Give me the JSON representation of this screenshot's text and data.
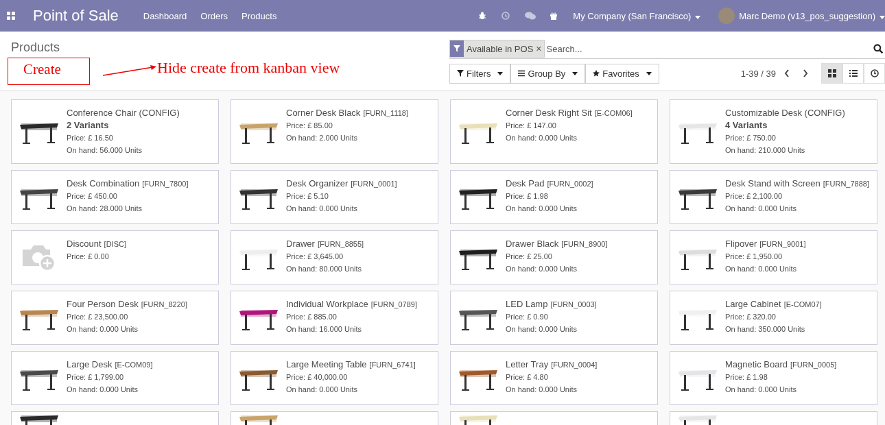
{
  "navbar": {
    "app_title": "Point of Sale",
    "menu": [
      {
        "label": "Dashboard"
      },
      {
        "label": "Orders"
      },
      {
        "label": "Products"
      }
    ],
    "company": "My Company (San Francisco)",
    "user": "Marc Demo (v13_pos_suggestion)"
  },
  "control_panel": {
    "breadcrumb": "Products",
    "facet": "Available in POS",
    "facet_remove": "×",
    "search_placeholder": "Search...",
    "filters": [
      {
        "kind": "filter",
        "label": "Filters"
      },
      {
        "kind": "group",
        "label": "Group By"
      },
      {
        "kind": "star",
        "label": "Favorites"
      }
    ],
    "pager": "1-39 / 39",
    "views": [
      {
        "kind": "kanban",
        "selected": true
      },
      {
        "kind": "list",
        "selected": false
      },
      {
        "kind": "activity",
        "selected": false
      }
    ]
  },
  "annotation": {
    "box_text": "Create",
    "note": "Hide create from kanban view"
  },
  "products": [
    {
      "name": "Conference Chair (CONFIG)",
      "variants": "2 Variants",
      "price": "Price: £ 16.50",
      "on_hand": "On hand: 56.000 Units",
      "kind": "picture"
    },
    {
      "name": "Corner Desk Black",
      "code": "[FURN_1118]",
      "price": "Price: £ 85.00",
      "on_hand": "On hand: 2.000 Units",
      "kind": "picture"
    },
    {
      "name": "Corner Desk Right Sit",
      "code": "[E-COM06]",
      "price": "Price: £ 147.00",
      "on_hand": "On hand: 0.000 Units",
      "kind": "picture"
    },
    {
      "name": "Customizable Desk (CONFIG)",
      "variants": "4 Variants",
      "price": "Price: £ 750.00",
      "on_hand": "On hand: 210.000 Units",
      "kind": "picture"
    },
    {
      "name": "Desk Combination",
      "code": "[FURN_7800]",
      "price": "Price: £ 450.00",
      "on_hand": "On hand: 28.000 Units",
      "kind": "picture"
    },
    {
      "name": "Desk Organizer",
      "code": "[FURN_0001]",
      "price": "Price: £ 5.10",
      "on_hand": "On hand: 0.000 Units",
      "kind": "picture"
    },
    {
      "name": "Desk Pad",
      "code": "[FURN_0002]",
      "price": "Price: £ 1.98",
      "on_hand": "On hand: 0.000 Units",
      "kind": "picture"
    },
    {
      "name": "Desk Stand with Screen",
      "code": "[FURN_7888]",
      "price": "Price: £ 2,100.00",
      "on_hand": "On hand: 0.000 Units",
      "kind": "picture"
    },
    {
      "name": "Discount",
      "code": "[DISC]",
      "price": "Price: £ 0.00",
      "kind": "placeholder"
    },
    {
      "name": "Drawer",
      "code": "[FURN_8855]",
      "price": "Price: £ 3,645.00",
      "on_hand": "On hand: 80.000 Units",
      "kind": "picture"
    },
    {
      "name": "Drawer Black",
      "code": "[FURN_8900]",
      "price": "Price: £ 25.00",
      "on_hand": "On hand: 0.000 Units",
      "kind": "picture"
    },
    {
      "name": "Flipover",
      "code": "[FURN_9001]",
      "price": "Price: £ 1,950.00",
      "on_hand": "On hand: 0.000 Units",
      "kind": "picture"
    },
    {
      "name": "Four Person Desk",
      "code": "[FURN_8220]",
      "price": "Price: £ 23,500.00",
      "on_hand": "On hand: 0.000 Units",
      "kind": "picture"
    },
    {
      "name": "Individual Workplace",
      "code": "[FURN_0789]",
      "price": "Price: £ 885.00",
      "on_hand": "On hand: 16.000 Units",
      "kind": "picture"
    },
    {
      "name": "LED Lamp",
      "code": "[FURN_0003]",
      "price": "Price: £ 0.90",
      "on_hand": "On hand: 0.000 Units",
      "kind": "picture"
    },
    {
      "name": "Large Cabinet",
      "code": "[E-COM07]",
      "price": "Price: £ 320.00",
      "on_hand": "On hand: 350.000 Units",
      "kind": "picture"
    },
    {
      "name": "Large Desk",
      "code": "[E-COM09]",
      "price": "Price: £ 1,799.00",
      "on_hand": "On hand: 0.000 Units",
      "kind": "picture"
    },
    {
      "name": "Large Meeting Table",
      "code": "[FURN_6741]",
      "price": "Price: £ 40,000.00",
      "on_hand": "On hand: 0.000 Units",
      "kind": "picture"
    },
    {
      "name": "Letter Tray",
      "code": "[FURN_0004]",
      "price": "Price: £ 4.80",
      "on_hand": "On hand: 0.000 Units",
      "kind": "picture"
    },
    {
      "name": "Magnetic Board",
      "code": "[FURN_0005]",
      "price": "Price: £ 1.98",
      "on_hand": "On hand: 0.000 Units",
      "kind": "picture"
    },
    {
      "kind": "picture"
    },
    {
      "kind": "picture"
    },
    {
      "kind": "picture"
    },
    {
      "kind": "picture"
    }
  ]
}
